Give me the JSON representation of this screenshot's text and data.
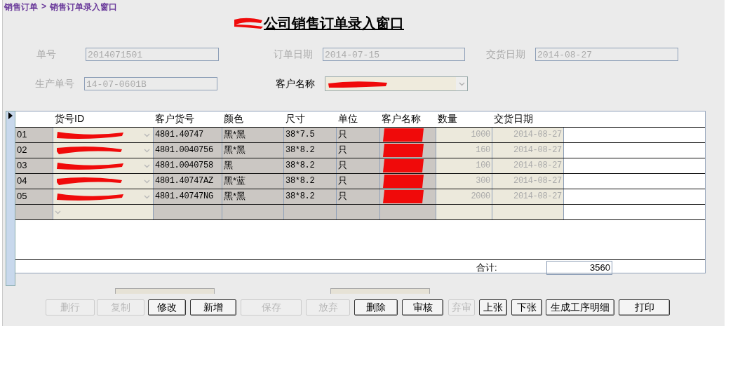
{
  "breadcrumb": {
    "parent": "销售订单",
    "separator": ">",
    "current": "销售订单录入窗口"
  },
  "title": "公司销售订单录入窗口",
  "fields": [
    {
      "label": "单号",
      "value": "2014071501",
      "kind": "text",
      "active": false
    },
    {
      "label": "订单日期",
      "value": "2014-07-15",
      "kind": "text",
      "active": false
    },
    {
      "label": "交货日期",
      "value": "2014-08-27",
      "kind": "text",
      "active": false
    },
    {
      "label": "生产单号",
      "value": "14-07-0601B",
      "kind": "text",
      "active": false
    },
    {
      "label": "客户名称",
      "kind": "dropdown",
      "active": true
    }
  ],
  "grid": {
    "columns": [
      "货号ID",
      "客户货号",
      "颜色",
      "尺寸",
      "单位",
      "客户名称",
      "数量",
      "交货日期"
    ],
    "rows": [
      {
        "no": "01",
        "customer_code": "4801.40747",
        "color_name": "黑*黑",
        "size": "38*7.5",
        "unit": "只",
        "quantity": "1000",
        "delivery_date": "2014-08-27"
      },
      {
        "no": "02",
        "customer_code": "4801.0040756",
        "color_name": "黑*黑",
        "size": "38*8.2",
        "unit": "只",
        "quantity": "160",
        "delivery_date": "2014-08-27"
      },
      {
        "no": "03",
        "customer_code": "4801.0040758",
        "color_name": "黑",
        "size": "38*8.2",
        "unit": "只",
        "quantity": "100",
        "delivery_date": "2014-08-27"
      },
      {
        "no": "04",
        "customer_code": "4801.40747AZ",
        "color_name": "黑*蓝",
        "size": "38*8.2",
        "unit": "只",
        "quantity": "300",
        "delivery_date": "2014-08-27"
      },
      {
        "no": "05",
        "customer_code": "4801.40747NG",
        "color_name": "黑*黑",
        "size": "38*8.2",
        "unit": "只",
        "quantity": "2000",
        "delivery_date": "2014-08-27"
      }
    ],
    "total_label": "合计:",
    "total_value": "3560"
  },
  "buttons": [
    {
      "label": "删行",
      "disabled": true
    },
    {
      "label": "复制",
      "disabled": true
    },
    {
      "label": "修改",
      "disabled": false
    },
    {
      "label": "新增",
      "disabled": false
    },
    {
      "label": "保存",
      "disabled": true
    },
    {
      "label": "放弃",
      "disabled": true
    },
    {
      "label": "删除",
      "disabled": false
    },
    {
      "label": "审核",
      "disabled": false
    },
    {
      "label": "弃审",
      "disabled": true
    },
    {
      "label": "上张",
      "disabled": false
    },
    {
      "label": "下张",
      "disabled": false
    },
    {
      "label": "生成工序明细",
      "disabled": false
    },
    {
      "label": "打印",
      "disabled": false
    }
  ]
}
